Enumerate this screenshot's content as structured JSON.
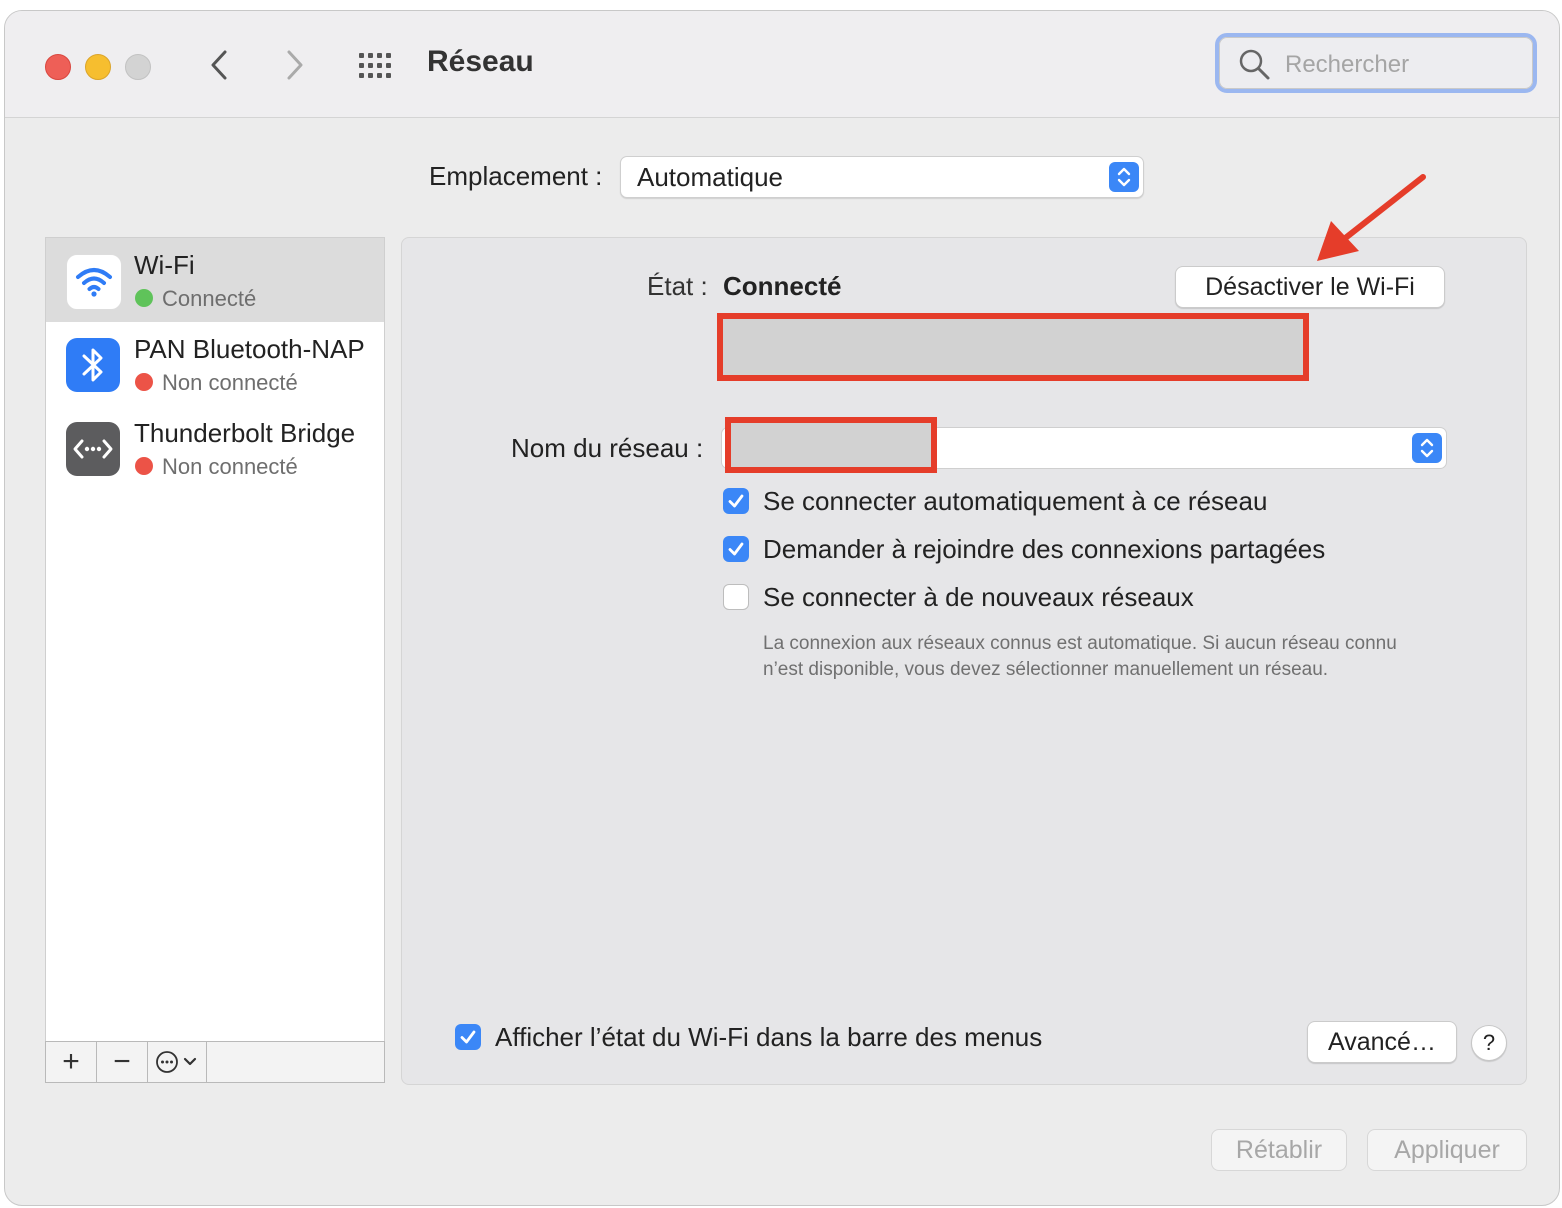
{
  "window": {
    "title": "Réseau",
    "search_placeholder": "Rechercher"
  },
  "location": {
    "label": "Emplacement :",
    "value": "Automatique"
  },
  "services": [
    {
      "name": "Wi-Fi",
      "status": "Connecté",
      "status_color": "#5fc35a",
      "icon": "wifi-icon",
      "selected": true
    },
    {
      "name": "PAN Bluetooth-NAP",
      "status": "Non connecté",
      "status_color": "#ec5347",
      "icon": "bluetooth-icon",
      "selected": false
    },
    {
      "name": "Thunderbolt Bridge",
      "status": "Non connecté",
      "status_color": "#ec5347",
      "icon": "thunderbolt-bridge-icon",
      "selected": false
    }
  ],
  "sidebar_toolbar": {
    "add": "+",
    "remove": "−"
  },
  "detail": {
    "state_label": "État :",
    "state_value": "Connecté",
    "toggle_wifi_button": "Désactiver le Wi-Fi",
    "network_name_label": "Nom du réseau :",
    "options": [
      {
        "label": "Se connecter automatiquement à ce réseau",
        "checked": true
      },
      {
        "label": "Demander à rejoindre des connexions partagées",
        "checked": true
      },
      {
        "label": "Se connecter à de nouveaux réseaux",
        "checked": false
      }
    ],
    "hint": "La connexion aux réseaux connus est automatique. Si aucun réseau connu n’est disponible, vous devez sélectionner manuellement un réseau.",
    "show_in_menubar": {
      "label": "Afficher l’état du Wi-Fi dans la barre des menus",
      "checked": true
    },
    "advanced_button": "Avancé…",
    "help_button": "?"
  },
  "footer": {
    "revert_button": "Rétablir",
    "apply_button": "Appliquer"
  },
  "colors": {
    "accent": "#3b87f7",
    "annotation_red": "#e53d2a"
  }
}
